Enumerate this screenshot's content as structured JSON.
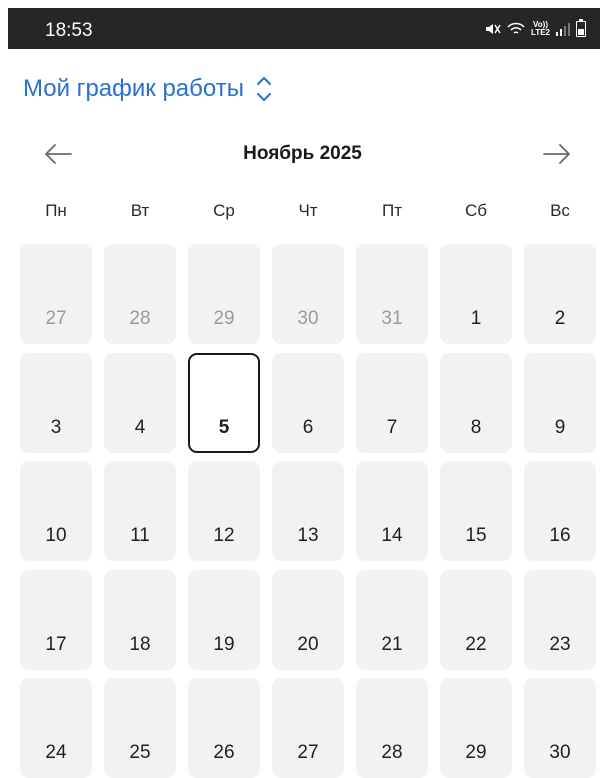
{
  "status_bar": {
    "time": "18:53",
    "network_label_top": "Vo))",
    "network_label_bottom": "LTE2"
  },
  "header": {
    "title": "Мой график работы"
  },
  "month_nav": {
    "label": "Ноябрь 2025"
  },
  "weekdays": [
    "Пн",
    "Вт",
    "Ср",
    "Чт",
    "Пт",
    "Сб",
    "Вс"
  ],
  "weeks": [
    [
      "27",
      "28",
      "29",
      "30",
      "31",
      "1",
      "2"
    ],
    [
      "3",
      "4",
      "5",
      "6",
      "7",
      "8",
      "9"
    ],
    [
      "10",
      "11",
      "12",
      "13",
      "14",
      "15",
      "16"
    ],
    [
      "17",
      "18",
      "19",
      "20",
      "21",
      "22",
      "23"
    ],
    [
      "24",
      "25",
      "26",
      "27",
      "28",
      "29",
      "30"
    ]
  ],
  "other_month_days": [
    [
      0,
      0
    ],
    [
      0,
      1
    ],
    [
      0,
      2
    ],
    [
      0,
      3
    ],
    [
      0,
      4
    ]
  ],
  "selected_day": [
    1,
    2
  ],
  "colors": {
    "accent": "#2a6fd4",
    "cell_bg": "#f1f2f3",
    "status_bar_bg": "#262626",
    "muted_text": "#9a9a9a"
  }
}
